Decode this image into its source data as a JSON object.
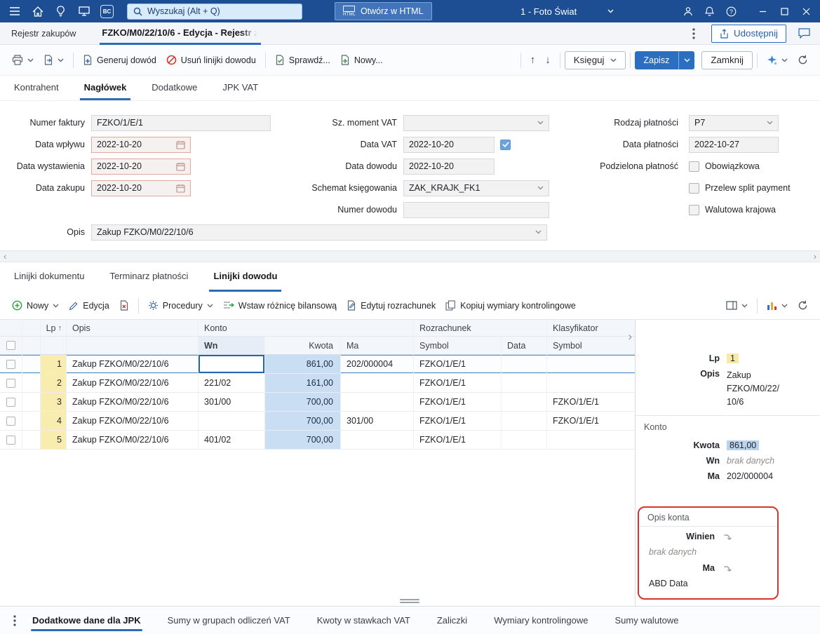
{
  "colors": {
    "topbar_bg": "#1d4e94",
    "accent_blue": "#2b6cb8",
    "primary_button_bg": "#2a6fc2",
    "kwota_cell_bg": "#c9ddf3",
    "lp_highlight_bg": "#f8ecae",
    "factbox_selection_bg": "#b9d4ee",
    "annotation_red": "#d6352b",
    "mandatory_field_border": "#dcab9f"
  },
  "icons": {
    "menu": "≡",
    "home": "⌂",
    "lightbulb": "☼",
    "monitor": "🖵",
    "bc_badge": "BC",
    "search": "🔍",
    "chevron_down": "▾",
    "person": "👤",
    "bell": "🔔",
    "help": "?",
    "minimize": "–",
    "maximize": "□",
    "close": "✕",
    "share": "↥",
    "feedback": "💬",
    "more_vertical": "⋮",
    "printer": "⎙",
    "export_document": "📄",
    "generate_document": "+",
    "delete_lines": "⊘",
    "check_document": "✓",
    "new_document": "+",
    "move_up": "↑",
    "move_down": "↓",
    "sparkle": "✦",
    "refresh": "⟳",
    "add_circle": "⊕",
    "edit_pencil": "✎",
    "delete_document": "✕",
    "procedures_gear": "⚙",
    "insert_arrow": "→",
    "copy_pages": "⧉",
    "layout_panel": "▤",
    "bar_chart": "▮▮▮",
    "calendar": "▦",
    "checkmark": "✓",
    "sort_ascending": "↑",
    "drilldown": "↴"
  },
  "topbar": {
    "search": {
      "placeholder": "Wyszukaj (Alt + Q)"
    },
    "open_html_button": "Otwórz w HTML",
    "html_icon_label": "HTML",
    "bc_badge": "BC",
    "company_picker": "1 - Foto Świat"
  },
  "doc_header": {
    "breadcrumb": "Rejestr zakupów",
    "title": "FZKO/M0/22/10/6 - Edycja - Rejestr z",
    "share_button": "Udostępnij"
  },
  "toolbar": {
    "generate_doc": "Generuj dowód",
    "delete_doc_lines": "Usuń linijki dowodu",
    "check": "Sprawdź...",
    "new": "Nowy...",
    "post": "Księguj",
    "save": "Zapisz",
    "close": "Zamknij"
  },
  "header_tabs": [
    {
      "label": "Kontrahent",
      "active": false
    },
    {
      "label": "Nagłówek",
      "active": true
    },
    {
      "label": "Dodatkowe",
      "active": false
    },
    {
      "label": "JPK VAT",
      "active": false
    }
  ],
  "form": {
    "invoice_no": {
      "label": "Numer faktury",
      "value": "FZKO/1/E/1"
    },
    "receipt_date": {
      "label": "Data wpływu",
      "value": "2022-10-20"
    },
    "issue_date": {
      "label": "Data wystawienia",
      "value": "2022-10-20"
    },
    "purchase_date": {
      "label": "Data zakupu",
      "value": "2022-10-20"
    },
    "description": {
      "label": "Opis",
      "value": "Zakup FZKO/M0/22/10/6"
    },
    "vat_moment": {
      "label": "Sz. moment VAT",
      "value": ""
    },
    "vat_date": {
      "label": "Data VAT",
      "value": "2022-10-20",
      "checked": true
    },
    "doc_date": {
      "label": "Data dowodu",
      "value": "2022-10-20"
    },
    "posting_schema": {
      "label": "Schemat księgowania",
      "value": "ZAK_KRAJK_FK1"
    },
    "doc_no": {
      "label": "Numer dowodu",
      "value": ""
    },
    "payment_type": {
      "label": "Rodzaj płatności",
      "value": "P7"
    },
    "payment_date": {
      "label": "Data płatności",
      "value": "2022-10-27"
    },
    "split_payment": {
      "label": "Podzielona płatność",
      "option": "Obowiązkowa",
      "checked": false
    },
    "split_transfer": {
      "label": "Przelew split payment",
      "checked": false
    },
    "domestic_currency": {
      "label": "Walutowa krajowa",
      "checked": false
    }
  },
  "section_tabs": [
    {
      "label": "Linijki dokumentu",
      "active": false
    },
    {
      "label": "Terminarz płatności",
      "active": false
    },
    {
      "label": "Linijki dowodu",
      "active": true
    }
  ],
  "grid_toolbar": {
    "new": "Nowy",
    "edit": "Edycja",
    "procedures": "Procedury",
    "insert_balance_diff": "Wstaw różnicę bilansową",
    "edit_settlement": "Edytuj rozrachunek",
    "copy_dimensions": "Kopiuj wymiary kontrolingowe"
  },
  "table": {
    "group_headers": {
      "konto": "Konto",
      "rozrachunek": "Rozrachunek",
      "klasyfikator": "Klasyfikator"
    },
    "headers": {
      "lp": "Lp",
      "opis": "Opis",
      "wn": "Wn",
      "kwota": "Kwota",
      "ma": "Ma",
      "symbol": "Symbol",
      "data": "Data",
      "symbol2": "Symbol"
    },
    "rows": [
      {
        "lp": "1",
        "opis": "Zakup FZKO/M0/22/10/6",
        "wn": "",
        "kwota": "861,00",
        "ma": "202/000004",
        "rozrachunek_symbol": "FZKO/1/E/1",
        "rozrachunek_data": "",
        "klasyfikator_symbol": ""
      },
      {
        "lp": "2",
        "opis": "Zakup FZKO/M0/22/10/6",
        "wn": "221/02",
        "kwota": "161,00",
        "ma": "",
        "rozrachunek_symbol": "FZKO/1/E/1",
        "rozrachunek_data": "",
        "klasyfikator_symbol": ""
      },
      {
        "lp": "3",
        "opis": "Zakup FZKO/M0/22/10/6",
        "wn": "301/00",
        "kwota": "700,00",
        "ma": "",
        "rozrachunek_symbol": "FZKO/1/E/1",
        "rozrachunek_data": "",
        "klasyfikator_symbol": "FZKO/1/E/1"
      },
      {
        "lp": "4",
        "opis": "Zakup FZKO/M0/22/10/6",
        "wn": "",
        "kwota": "700,00",
        "ma": "301/00",
        "rozrachunek_symbol": "FZKO/1/E/1",
        "rozrachunek_data": "",
        "klasyfikator_symbol": "FZKO/1/E/1"
      },
      {
        "lp": "5",
        "opis": "Zakup FZKO/M0/22/10/6",
        "wn": "401/02",
        "kwota": "700,00",
        "ma": "",
        "rozrachunek_symbol": "FZKO/1/E/1",
        "rozrachunek_data": "",
        "klasyfikator_symbol": ""
      }
    ]
  },
  "factbox": {
    "lp": {
      "label": "Lp",
      "value": "1"
    },
    "opis": {
      "label": "Opis",
      "value": "Zakup FZKO/M0/22/10/6"
    },
    "konto_section": "Konto",
    "kwota": {
      "label": "Kwota",
      "value": "861,00"
    },
    "wn": {
      "label": "Wn",
      "value": "brak danych"
    },
    "ma": {
      "label": "Ma",
      "value": "202/000004"
    },
    "opis_konta_section": "Opis konta",
    "winien": {
      "label": "Winien",
      "value": "brak danych"
    },
    "ma2": {
      "label": "Ma",
      "value": "ABD Data"
    }
  },
  "bottom_tabs": [
    {
      "label": "Dodatkowe dane dla JPK",
      "active": true
    },
    {
      "label": "Sumy w grupach odliczeń VAT",
      "active": false
    },
    {
      "label": "Kwoty w stawkach VAT",
      "active": false
    },
    {
      "label": "Zaliczki",
      "active": false
    },
    {
      "label": "Wymiary kontrolingowe",
      "active": false
    },
    {
      "label": "Sumy walutowe",
      "active": false
    }
  ]
}
